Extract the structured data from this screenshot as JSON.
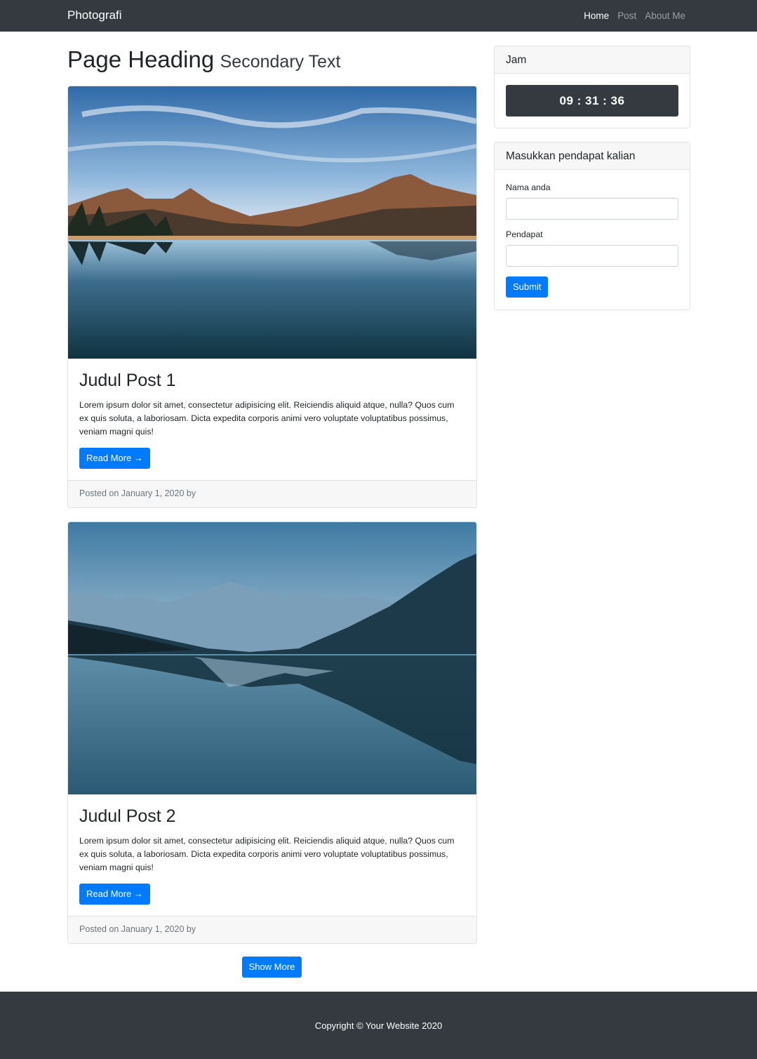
{
  "navbar": {
    "brand": "Photografi",
    "links": [
      {
        "label": "Home"
      },
      {
        "label": "Post"
      },
      {
        "label": "About Me"
      }
    ]
  },
  "heading": {
    "main": "Page Heading",
    "sub": "Secondary Text"
  },
  "posts": [
    {
      "title": "Judul Post 1",
      "text": "Lorem ipsum dolor sit amet, consectetur adipisicing elit. Reiciendis aliquid atque, nulla? Quos cum ex quis soluta, a laboriosam. Dicta expedita corporis animi vero voluptate voluptatibus possimus, veniam magni quis!",
      "button": "Read More →",
      "footer": "Posted on January 1, 2020 by"
    },
    {
      "title": "Judul Post 2",
      "text": "Lorem ipsum dolor sit amet, consectetur adipisicing elit. Reiciendis aliquid atque, nulla? Quos cum ex quis soluta, a laboriosam. Dicta expedita corporis animi vero voluptate voluptatibus possimus, veniam magni quis!",
      "button": "Read More →",
      "footer": "Posted on January 1, 2020 by"
    }
  ],
  "show_more": "Show More",
  "clock_widget": {
    "title": "Jam",
    "time": "09 : 31 : 36"
  },
  "form_widget": {
    "title": "Masukkan pendapat kalian",
    "name_label": "Nama anda",
    "name_value": "",
    "opinion_label": "Pendapat",
    "opinion_value": "",
    "submit": "Submit"
  },
  "footer": {
    "text": "Copyright © Your Website 2020"
  },
  "colors": {
    "navbar": "#343a40",
    "primary": "#007bff",
    "footer": "#343a40"
  }
}
